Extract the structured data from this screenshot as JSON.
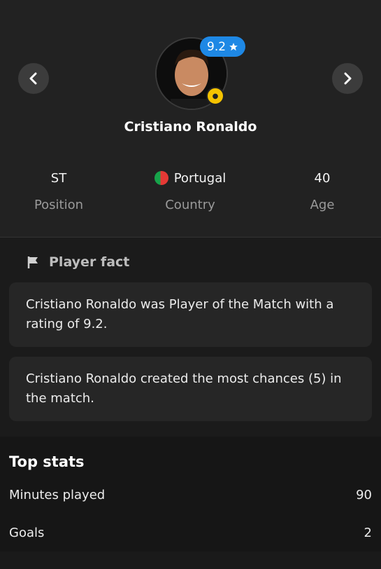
{
  "player": {
    "name": "Cristiano Ronaldo",
    "rating": "9.2",
    "position_value": "ST",
    "position_label": "Position",
    "country_value": "Portugal",
    "country_label": "Country",
    "age_value": "40",
    "age_label": "Age"
  },
  "facts": {
    "title": "Player fact",
    "items": [
      "Cristiano Ronaldo was Player of the Match with a rating of 9.2.",
      "Cristiano Ronaldo created the most chances (5) in the match."
    ]
  },
  "top_stats": {
    "title": "Top stats",
    "rows": [
      {
        "label": "Minutes played",
        "value": "90"
      },
      {
        "label": "Goals",
        "value": "2"
      }
    ]
  },
  "colors": {
    "accent": "#1e88e5",
    "background": "#1a1a1a"
  },
  "icons": [
    "chevron-left-icon",
    "chevron-right-icon",
    "star-icon",
    "flag-icon",
    "portugal-flag-icon"
  ]
}
